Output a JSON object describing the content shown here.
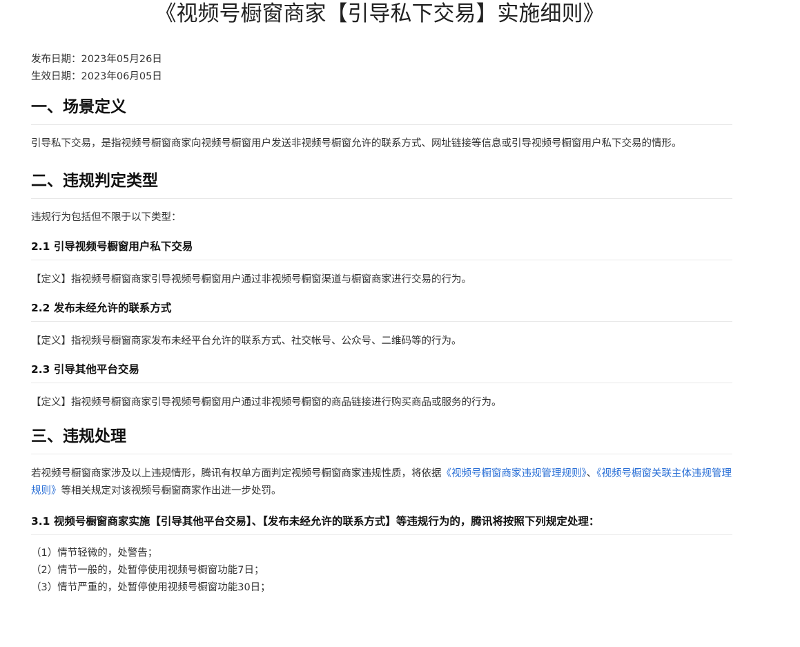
{
  "title": "《视频号橱窗商家【引导私下交易】实施细则》",
  "meta": {
    "publish_date": "发布日期：2023年05月26日",
    "effective_date": "生效日期：2023年06月05日"
  },
  "section1": {
    "heading": "一、场景定义",
    "body": "引导私下交易，是指视频号橱窗商家向视频号橱窗用户发送非视频号橱窗允许的联系方式、网址链接等信息或引导视频号橱窗用户私下交易的情形。"
  },
  "section2": {
    "heading": "二、违规判定类型",
    "intro": "违规行为包括但不限于以下类型：",
    "items": [
      {
        "heading": "2.1 引导视频号橱窗用户私下交易",
        "body": "【定义】指视频号橱窗商家引导视频号橱窗用户通过非视频号橱窗渠道与橱窗商家进行交易的行为。"
      },
      {
        "heading": "2.2 发布未经允许的联系方式",
        "body": "【定义】指视频号橱窗商家发布未经平台允许的联系方式、社交帐号、公众号、二维码等的行为。"
      },
      {
        "heading": "2.3 引导其他平台交易",
        "body": "【定义】指视频号橱窗商家引导视频号橱窗用户通过非视频号橱窗的商品链接进行购买商品或服务的行为。"
      }
    ]
  },
  "section3": {
    "heading": "三、违规处理",
    "body_prefix": "若视频号橱窗商家涉及以上违规情形，腾讯有权单方面判定视频号橱窗商家违规性质，将依据",
    "link1": "《视频号橱窗商家违规管理规则》",
    "separator": "、",
    "link2": "《视频号橱窗关联主体违规管理规则》",
    "body_suffix": "等相关规定对该视频号橱窗商家作出进一步处罚。",
    "sub_heading": "3.1 视频号橱窗商家实施【引导其他平台交易】、【发布未经允许的联系方式】等违规行为的，腾讯将按照下列规定处理：",
    "penalties": [
      "（1）情节轻微的，处警告；",
      "（2）情节一般的，处暂停使用视频号橱窗功能7日；",
      "（3）情节严重的，处暂停使用视频号橱窗功能30日；"
    ]
  }
}
